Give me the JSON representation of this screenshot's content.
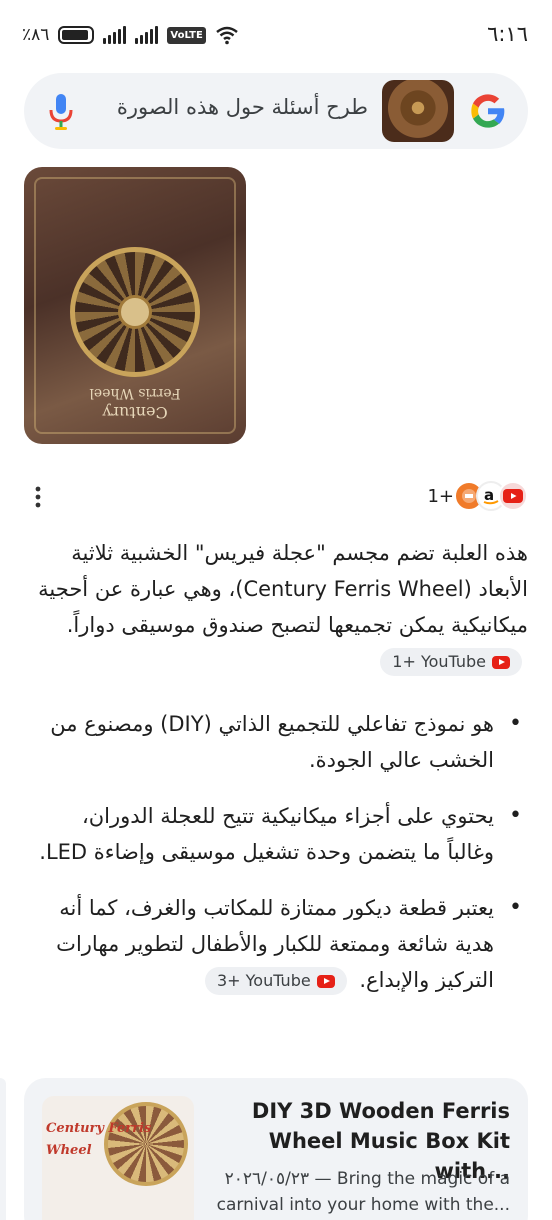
{
  "status_bar": {
    "time": "٦:١٦",
    "battery_percent": "٪٨٦",
    "network_label": "VoLTE",
    "sim_index": "2"
  },
  "search": {
    "placeholder": "طرح أسئلة حول هذه الصورة"
  },
  "sources": {
    "count": "1+"
  },
  "answer": {
    "paragraph": "هذه العلبة تضم مجسم \"عجلة فيريس\" الخشبية ثلاثية الأبعاد (Century Ferris Wheel)، وهي عبارة عن أحجية ميكانيكية يمكن تجميعها لتصبح صندوق موسيقى دواراً.",
    "chip": "1+ YouTube"
  },
  "bullets": [
    {
      "text": "هو نموذج تفاعلي للتجميع الذاتي (DIY) ومصنوع من الخشب عالي الجودة."
    },
    {
      "text": "يحتوي على أجزاء ميكانيكية تتيح للعجلة الدوران، وغالباً ما يتضمن وحدة تشغيل موسيقى وإضاءة LED."
    },
    {
      "text": "يعتبر قطعة ديكور ممتازة للمكاتب والغرف، كما أنه هدية شائعة وممتعة للكبار والأطفال لتطوير مهارات التركيز والإبداع.",
      "chip": "3+ YouTube"
    }
  ],
  "image": {
    "box_line1": "Century",
    "box_line2": "Ferris Wheel"
  },
  "card": {
    "title": "DIY 3D Wooden Ferris Wheel Music Box Kit with...",
    "snippet": "٢٠٢٦/٠٥/٢٣ — Bring the magic of a carnival into your home with the...",
    "thumb_text": "Century Ferris Wheel"
  },
  "colors": {
    "accent_blue": "#4285F4",
    "youtube_red": "#E62117",
    "surface": "#F1F3F6"
  }
}
